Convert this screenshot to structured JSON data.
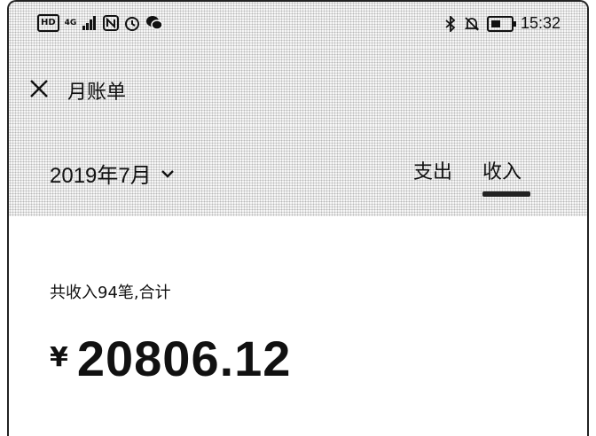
{
  "status_bar": {
    "left_badges": [
      "HD",
      "4G"
    ],
    "time": "15:32"
  },
  "header": {
    "title": "月账单"
  },
  "month_selector": {
    "label": "2019年7月"
  },
  "tabs": [
    {
      "label": "支出",
      "selected": false
    },
    {
      "label": "收入",
      "selected": true
    }
  ],
  "summary": {
    "text": "共收入94笔,合计",
    "currency": "¥",
    "total": "20806.12"
  }
}
